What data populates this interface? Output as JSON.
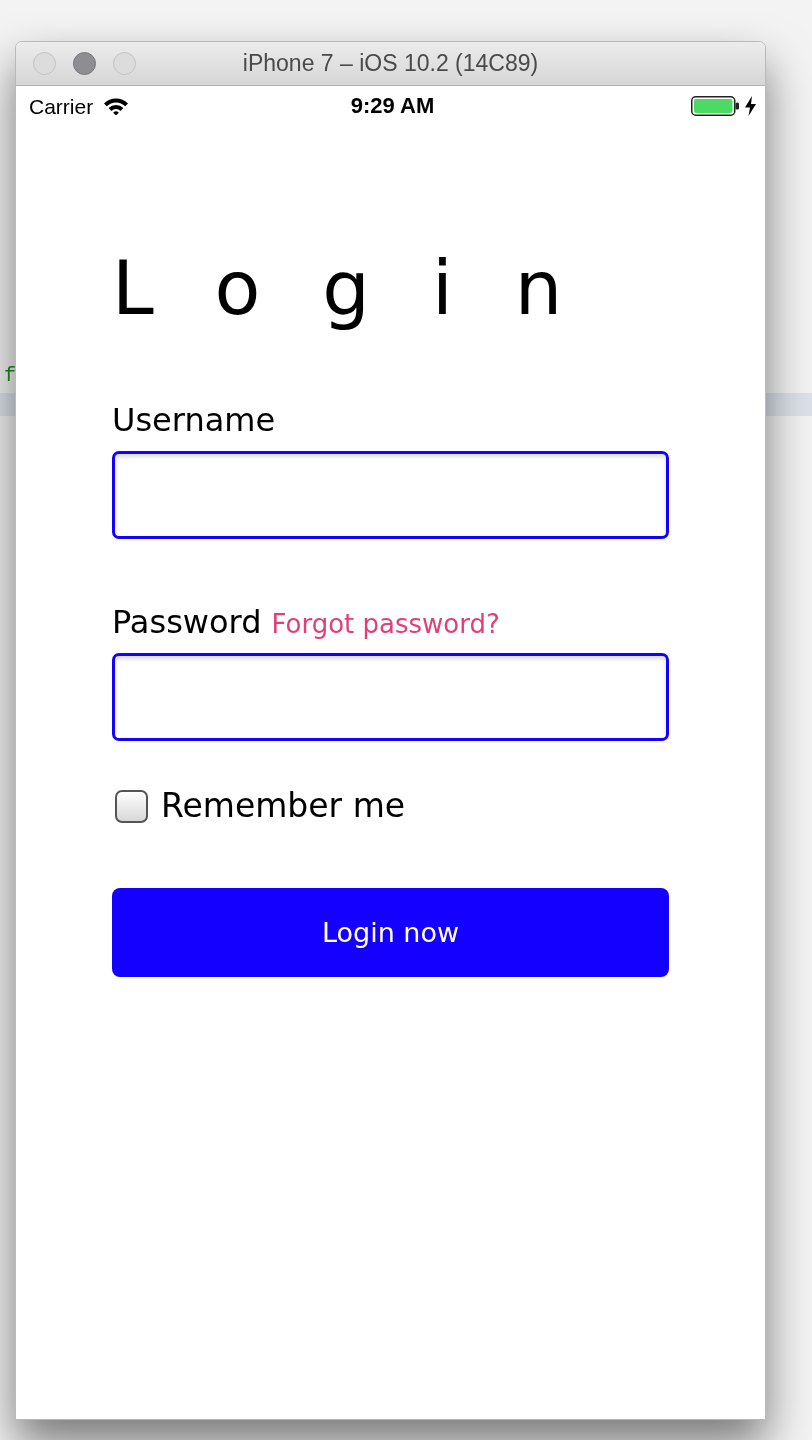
{
  "background": {
    "code_text": "f"
  },
  "window": {
    "title": "iPhone 7 – iOS 10.2 (14C89)",
    "controls": [
      {
        "highlighted": false
      },
      {
        "highlighted": true
      },
      {
        "highlighted": false
      }
    ]
  },
  "status_bar": {
    "carrier": "Carrier",
    "time": "9:29 AM",
    "charging": true
  },
  "login": {
    "title": "Login",
    "fields": [
      {
        "label": "Username"
      },
      {
        "label": "Password",
        "link": "Forgot password?"
      }
    ],
    "remember": {
      "label": "Remember me",
      "checked": false
    },
    "button": {
      "label": "Login now"
    }
  }
}
